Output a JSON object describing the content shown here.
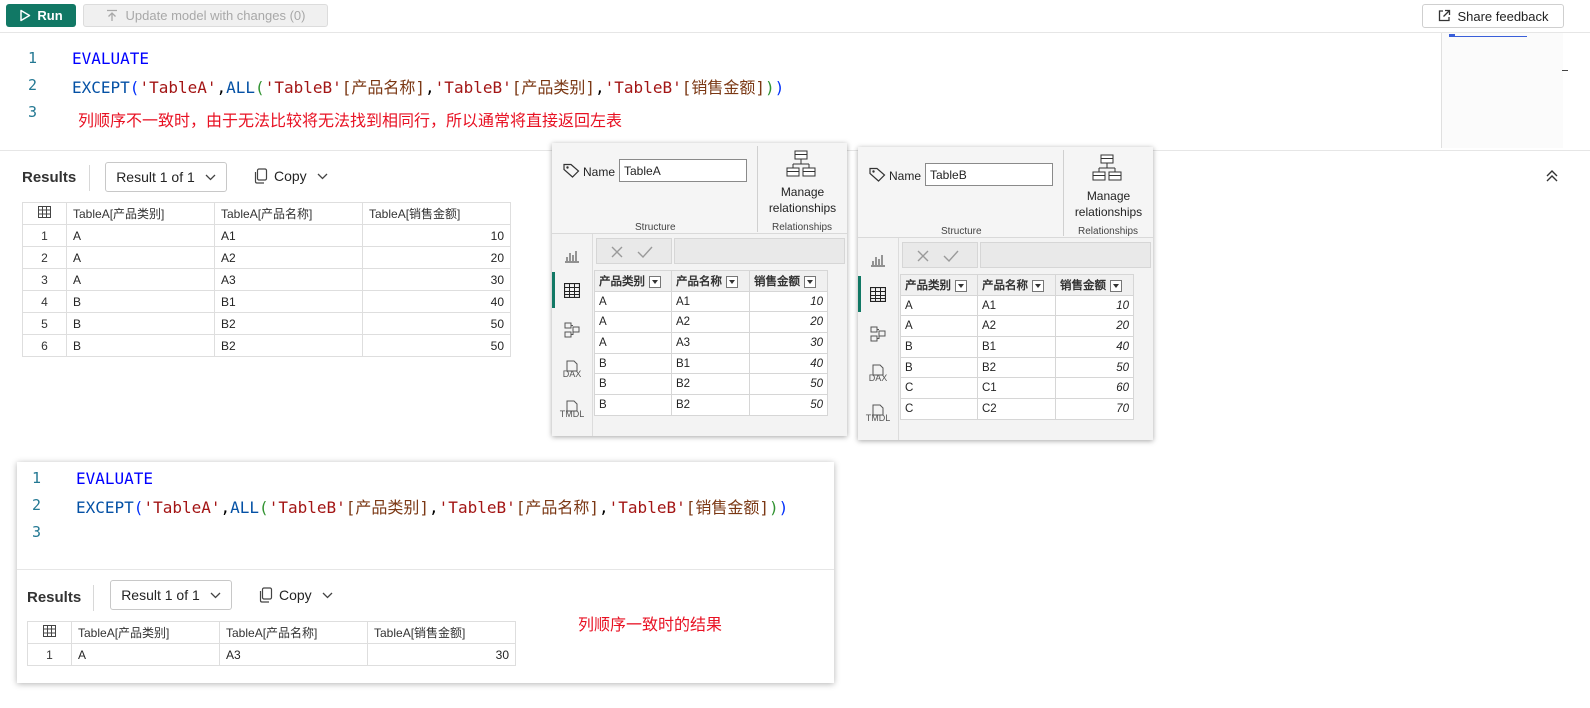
{
  "toolbar": {
    "run_label": "Run",
    "update_label": "Update model with changes (0)",
    "share_label": "Share feedback"
  },
  "editor1": {
    "line_numbers": [
      "1",
      "2",
      "3"
    ],
    "line1": "EVALUATE",
    "line2": {
      "fn": "EXCEPT",
      "t1": "'TableA'",
      "all": "ALL",
      "c1t": "'TableB'",
      "c1": "[产品名称]",
      "c2t": "'TableB'",
      "c2": "[产品类别]",
      "c3t": "'TableB'",
      "c3": "[销售金额]"
    },
    "note": "列顺序不一致时，由于无法比较将无法找到相同行，所以通常将直接返回左表"
  },
  "results1": {
    "label": "Results",
    "dropdown": "Result 1 of 1",
    "copy": "Copy",
    "headers": [
      "TableA[产品类别]",
      "TableA[产品名称]",
      "TableA[销售金额]"
    ],
    "rows": [
      [
        "1",
        "A",
        "A1",
        "10"
      ],
      [
        "2",
        "A",
        "A2",
        "20"
      ],
      [
        "3",
        "A",
        "A3",
        "30"
      ],
      [
        "4",
        "B",
        "B1",
        "40"
      ],
      [
        "5",
        "B",
        "B2",
        "50"
      ],
      [
        "6",
        "B",
        "B2",
        "50"
      ]
    ]
  },
  "panelA": {
    "name_label": "Name",
    "name_value": "TableA",
    "structure": "Structure",
    "manage1": "Manage",
    "manage2": "relationships",
    "relationships": "Relationships",
    "headers": [
      "产品类别",
      "产品名称",
      "销售金额"
    ],
    "rows": [
      [
        "A",
        "A1",
        "10"
      ],
      [
        "A",
        "A2",
        "20"
      ],
      [
        "A",
        "A3",
        "30"
      ],
      [
        "B",
        "B1",
        "40"
      ],
      [
        "B",
        "B2",
        "50"
      ],
      [
        "B",
        "B2",
        "50"
      ]
    ]
  },
  "panelB": {
    "name_label": "Name",
    "name_value": "TableB",
    "structure": "Structure",
    "manage1": "Manage",
    "manage2": "relationships",
    "relationships": "Relationships",
    "headers": [
      "产品类别",
      "产品名称",
      "销售金额"
    ],
    "rows": [
      [
        "A",
        "A1",
        "10"
      ],
      [
        "A",
        "A2",
        "20"
      ],
      [
        "B",
        "B1",
        "40"
      ],
      [
        "B",
        "B2",
        "50"
      ],
      [
        "C",
        "C1",
        "60"
      ],
      [
        "C",
        "C2",
        "70"
      ]
    ]
  },
  "side_icons": [
    "DAX",
    "TMDL"
  ],
  "editor2": {
    "line_numbers": [
      "1",
      "2",
      "3"
    ],
    "line1": "EVALUATE",
    "line2": {
      "fn": "EXCEPT",
      "t1": "'TableA'",
      "all": "ALL",
      "c1t": "'TableB'",
      "c1": "[产品类别]",
      "c2t": "'TableB'",
      "c2": "[产品名称]",
      "c3t": "'TableB'",
      "c3": "[销售金额]"
    }
  },
  "results2": {
    "label": "Results",
    "dropdown": "Result 1 of 1",
    "copy": "Copy",
    "headers": [
      "TableA[产品类别]",
      "TableA[产品名称]",
      "TableA[销售金额]"
    ],
    "rows": [
      [
        "1",
        "A",
        "A3",
        "30"
      ]
    ],
    "note": "列顺序一致时的结果"
  },
  "colors": {
    "accent": "#117865",
    "note": "#e81123",
    "keyword": "#0000ff",
    "string": "#a31515"
  }
}
